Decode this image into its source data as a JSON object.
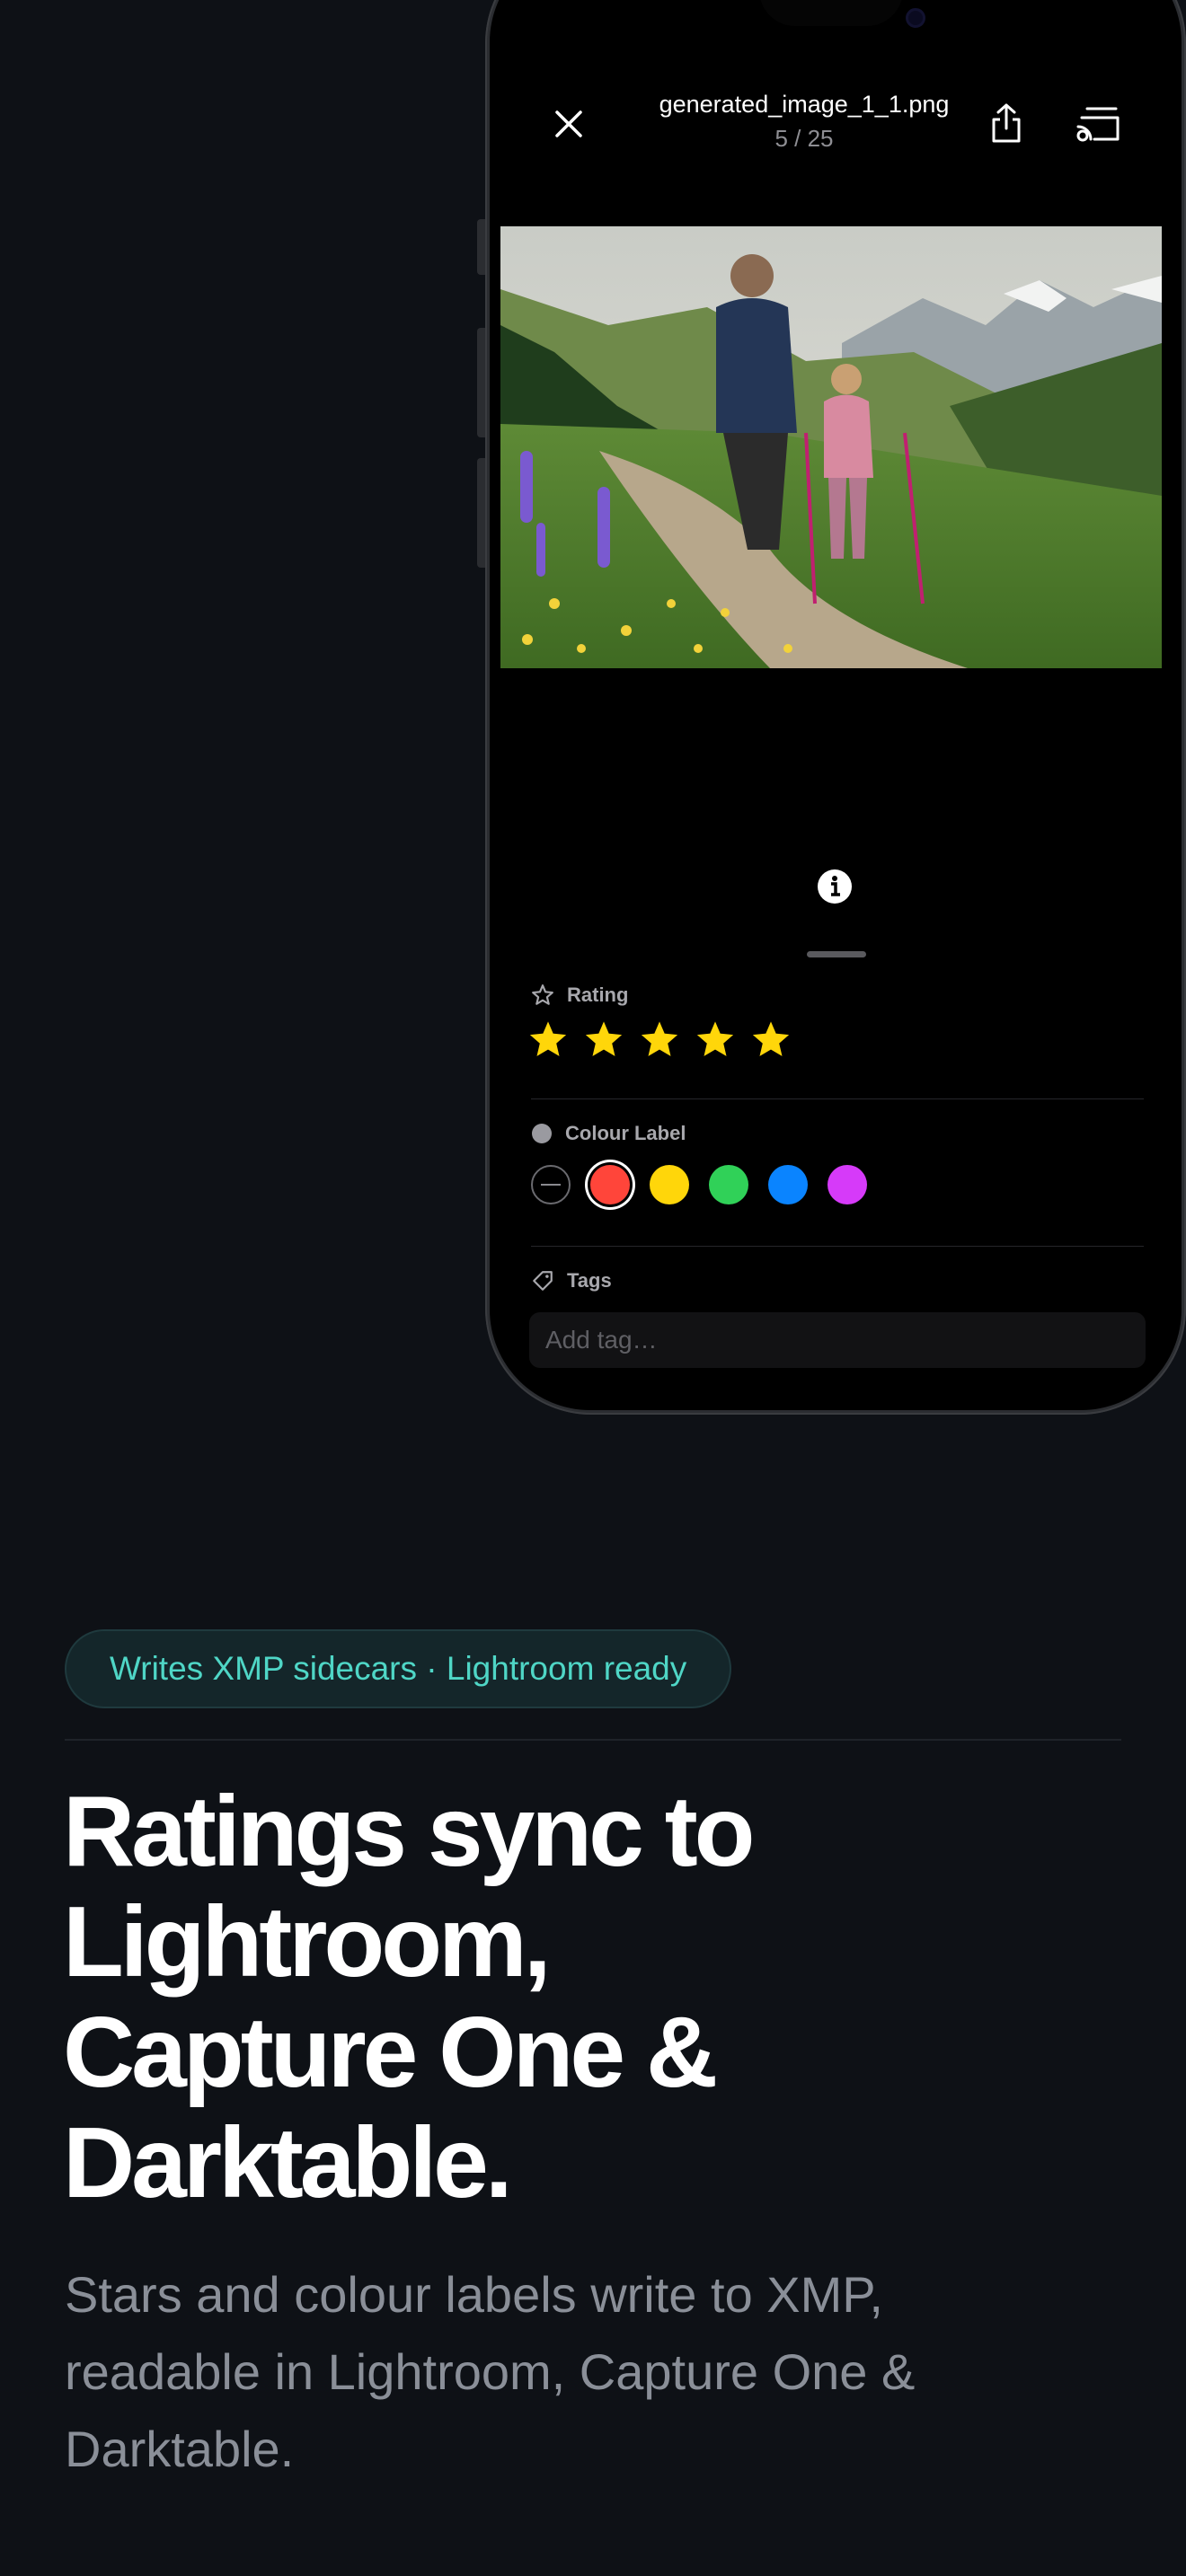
{
  "viewer": {
    "filename": "generated_image_1_1.png",
    "counter": "5 / 25",
    "close_icon": "close-icon",
    "share_icon": "share-icon",
    "cast_icon": "cast-icon",
    "info_icon": "info-icon"
  },
  "panel": {
    "rating_label": "Rating",
    "rating_value": 5,
    "rating_max": 5,
    "colour_label": "Colour Label",
    "colours": [
      "none",
      "#ff453a",
      "#ffd60a",
      "#30d158",
      "#0a84ff",
      "#d63af9"
    ],
    "selected_colour": "#ff453a",
    "tags_label": "Tags",
    "tag_placeholder": "Add tag…",
    "star_color": "#ffd60a"
  },
  "marketing": {
    "pill": "Writes XMP sidecars · Lightroom ready",
    "headline_lines": [
      "Ratings sync to",
      "Lightroom,",
      "Capture One &",
      "Darktable."
    ],
    "subcopy": "Stars and colour labels write to XMP, readable in Lightroom, Capture One & Darktable."
  },
  "colors": {
    "background": "#0e1116",
    "accent_teal": "#4fd6c6"
  }
}
